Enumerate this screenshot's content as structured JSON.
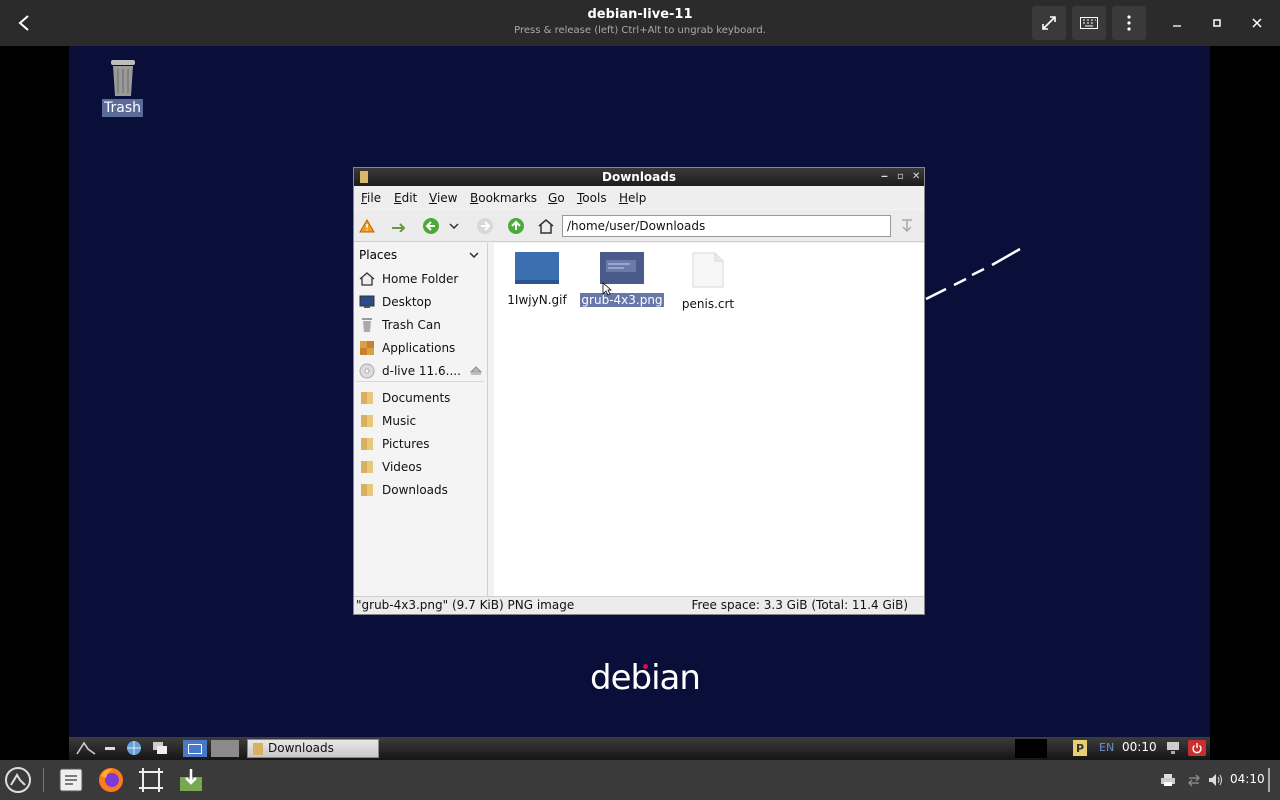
{
  "viewer": {
    "title": "debian-live-11",
    "subtitle": "Press & release (left) Ctrl+Alt to ungrab keyboard."
  },
  "desktop": {
    "trash_label": "Trash",
    "logo_text": "debian"
  },
  "file_manager": {
    "title": "Downloads",
    "menu": [
      "File",
      "Edit",
      "View",
      "Bookmarks",
      "Go",
      "Tools",
      "Help"
    ],
    "path": "/home/user/Downloads",
    "places_header": "Places",
    "places": [
      {
        "label": "Home Folder",
        "icon": "home-icon"
      },
      {
        "label": "Desktop",
        "icon": "desktop-icon"
      },
      {
        "label": "Trash Can",
        "icon": "trash-icon"
      },
      {
        "label": "Applications",
        "icon": "applications-icon"
      },
      {
        "label": "d-live 11.6....",
        "icon": "drive-icon"
      }
    ],
    "bookmarks": [
      {
        "label": "Documents",
        "icon": "folder-icon"
      },
      {
        "label": "Music",
        "icon": "folder-icon"
      },
      {
        "label": "Pictures",
        "icon": "folder-icon"
      },
      {
        "label": "Videos",
        "icon": "folder-icon"
      },
      {
        "label": "Downloads",
        "icon": "folder-icon"
      }
    ],
    "files": [
      {
        "name": "1IwjyN.gif",
        "icon": "image-thumbnail-icon",
        "selected": false
      },
      {
        "name": "grub-4x3.png",
        "icon": "image-thumbnail-icon",
        "selected": true
      },
      {
        "name": "penis.crt",
        "icon": "document-icon",
        "selected": false
      }
    ],
    "status_left": "\"grub-4x3.png\" (9.7 KiB) PNG image",
    "status_right": "Free space: 3.3 GiB (Total: 11.4 GiB)"
  },
  "guest_panel": {
    "task_label": "Downloads",
    "lang": "EN",
    "clock": "00:10"
  },
  "host_panel": {
    "clock": "04:10"
  }
}
